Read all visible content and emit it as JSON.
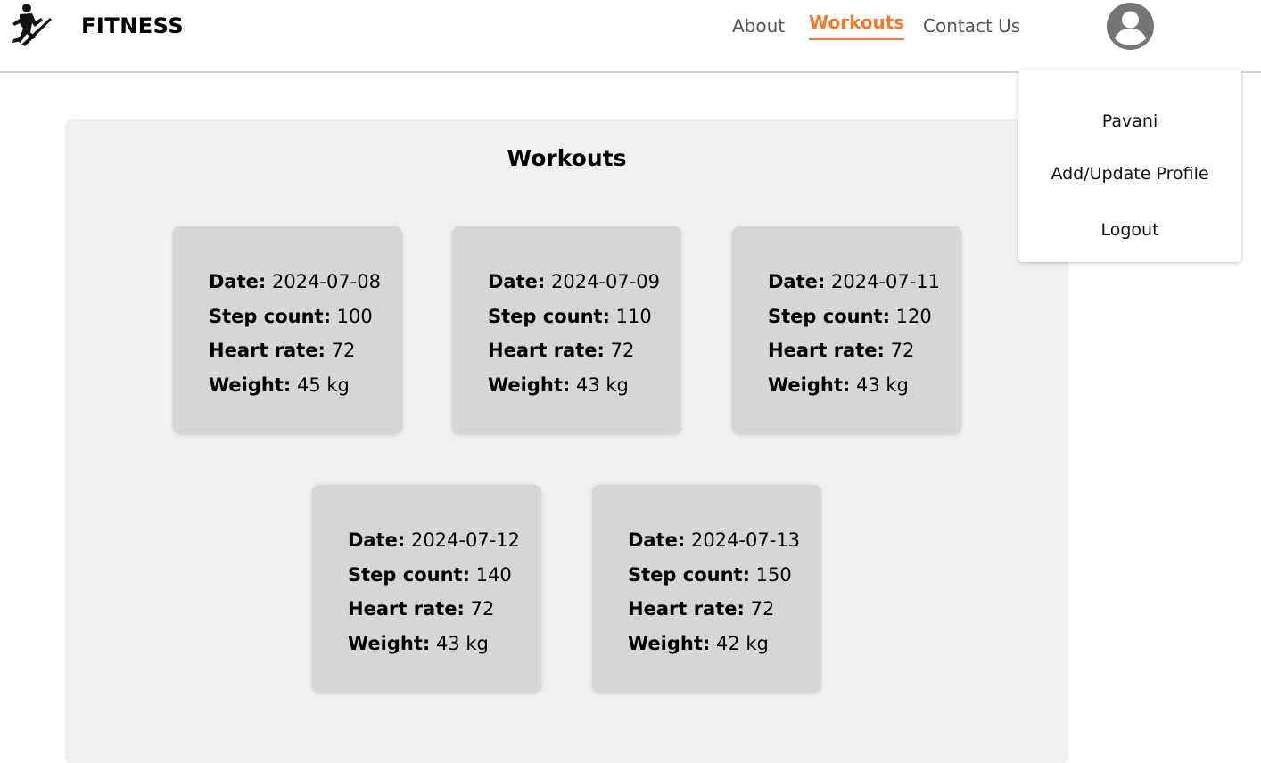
{
  "header": {
    "brand": "FITNESS",
    "nav": {
      "about": "About",
      "workouts": "Workouts",
      "contact": "Contact Us"
    },
    "accent_color": "#f5782a"
  },
  "user_menu": {
    "name": "Pavani",
    "profile_label": "Add/Update Profile",
    "logout_label": "Logout"
  },
  "main": {
    "title": "Workouts",
    "labels": {
      "date": "Date:",
      "steps": "Step count:",
      "heart": "Heart rate:",
      "weight": "Weight:"
    },
    "workouts": [
      {
        "date": "2024-07-08",
        "steps": "100",
        "heart": "72",
        "weight": "45 kg"
      },
      {
        "date": "2024-07-09",
        "steps": "110",
        "heart": "72",
        "weight": "43 kg"
      },
      {
        "date": "2024-07-11",
        "steps": "120",
        "heart": "72",
        "weight": "43 kg"
      },
      {
        "date": "2024-07-12",
        "steps": "140",
        "heart": "72",
        "weight": "43 kg"
      },
      {
        "date": "2024-07-13",
        "steps": "150",
        "heart": "72",
        "weight": "42 kg"
      }
    ]
  },
  "icons": {
    "logo": "runner-logo-icon",
    "avatar": "user-avatar-icon"
  }
}
